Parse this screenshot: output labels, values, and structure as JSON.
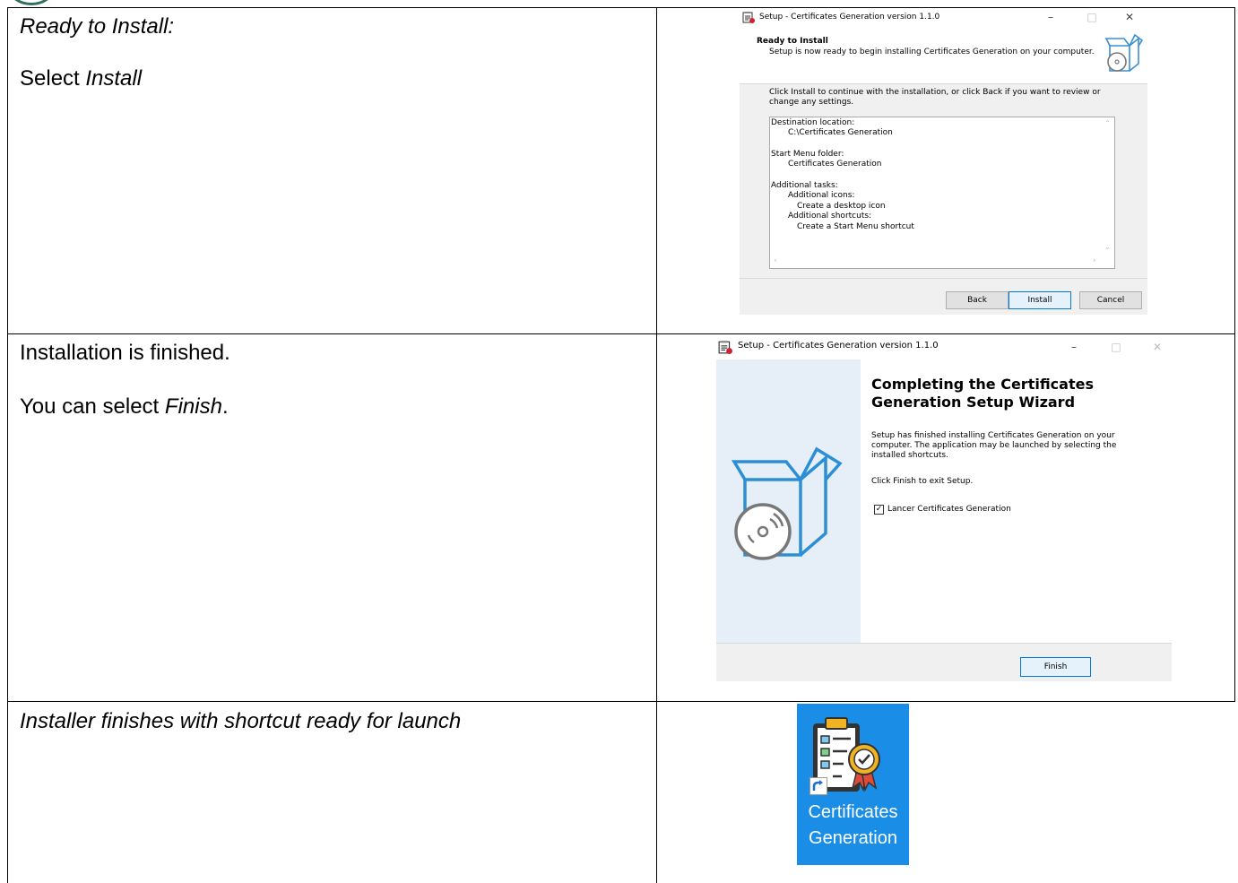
{
  "rows": [
    {
      "line1": "Ready to Install:",
      "line2_prefix": "Select ",
      "line2_emphasis": "Install"
    },
    {
      "line1": "Installation is finished.",
      "line2_prefix": "You can select ",
      "line2_emphasis": "Finish",
      "line2_suffix": "."
    },
    {
      "line1": "Installer finishes with shortcut ready for launch"
    }
  ],
  "ready_dialog": {
    "window_title": "Setup - Certificates Generation version 1.1.0",
    "heading": "Ready to Install",
    "subheading": "Setup is now ready to begin installing Certificates Generation on your computer.",
    "instruction_line1": "Click Install to continue with the installation, or click Back if you want to review or",
    "instruction_line2": "change any settings.",
    "summary": [
      "Destination location:",
      "C:\\Certificates Generation",
      "Start Menu folder:",
      "Certificates Generation",
      "Additional tasks:",
      "Additional icons:",
      "Create a desktop icon",
      "Additional shortcuts:",
      "Create a Start Menu shortcut"
    ],
    "buttons": {
      "back": "Back",
      "install": "Install",
      "cancel": "Cancel"
    }
  },
  "finish_dialog": {
    "window_title": "Setup - Certificates Generation version 1.1.0",
    "title_line1": "Completing the Certificates",
    "title_line2": "Generation Setup Wizard",
    "body_line1": "Setup has finished installing Certificates Generation on your",
    "body_line2": "computer. The application may be launched by selecting the",
    "body_line3": "installed shortcuts.",
    "exit_text": "Click Finish to exit Setup.",
    "checkbox_label": "Lancer Certificates Generation",
    "checkbox_checked": true,
    "finish_button": "Finish"
  },
  "shortcut": {
    "label_line1": "Certificates",
    "label_line2": "Generation",
    "background": "#1a8ee6"
  },
  "icons": {
    "window_icon": "setup-installer-icon",
    "box": "software-box-icon",
    "shortcut_arrow": "shortcut-arrow-icon"
  }
}
